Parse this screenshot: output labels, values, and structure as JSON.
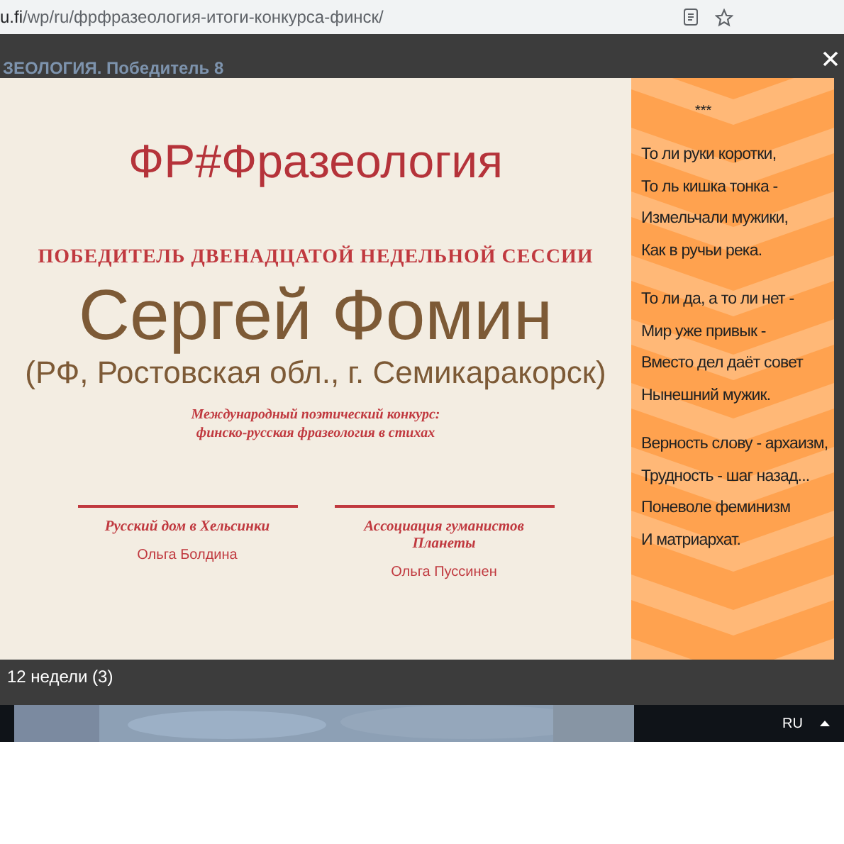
{
  "address_bar": {
    "host": "u.fi",
    "path": "/wp/ru/фрфразеология-итоги-конкурса-финск/"
  },
  "background_snippet": "ЗЕОЛОГИЯ. Победитель 8",
  "certificate": {
    "brand": "ФР#Фразеология",
    "heading": "ПОБЕДИТЕЛЬ ДВЕНАДЦАТОЙ НЕДЕЛЬНОЙ СЕССИИ",
    "winner": "Сергей Фомин",
    "location": "(РФ, Ростовская обл., г. Семикаракорск)",
    "contest": [
      "Международный поэтический конкурс:",
      "финско-русская фразеология в стихах"
    ],
    "signatures": [
      {
        "org": "Русский дом в Хельсинки",
        "person": "Ольга Болдина"
      },
      {
        "org": "Ассоциация гуманистов Планеты",
        "person": "Ольга Пуссинен"
      }
    ]
  },
  "poem": {
    "mark": "***",
    "stanzas": [
      [
        "То ли руки коротки,",
        "То ль кишка тонка -",
        "Измельчали мужики,",
        "Как в ручьи река."
      ],
      [
        "То ли да, а то ли нет -",
        "Мир уже привык -",
        "Вместо дел даёт совет",
        "Нынешний мужик."
      ],
      [
        "Верность слову - архаизм,",
        "Трудность - шаг назад...",
        "Поневоле феминизм",
        "И матриархат."
      ]
    ]
  },
  "caption": "12 недели (3)",
  "taskbar": {
    "language": "RU"
  }
}
